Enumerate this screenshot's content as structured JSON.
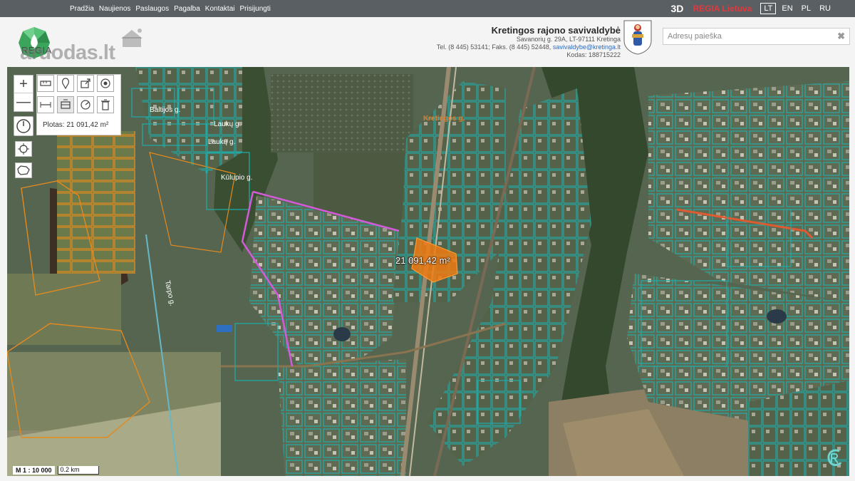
{
  "nav": {
    "items": [
      "Pradžia",
      "Naujienos",
      "Paslaugos",
      "Pagalba",
      "Kontaktai",
      "Prisijungti"
    ],
    "btn_3d": "3D",
    "regia_lietuva": "REGIA Lietuva",
    "languages": [
      "LT",
      "EN",
      "PL",
      "RU"
    ],
    "active_language": "LT"
  },
  "header": {
    "logo_text": "REGIA",
    "watermark": "aruodas.lt",
    "municipality": "Kretingos rajono savivaldybė",
    "address": "Savanorių g. 29A, LT-97111 Kretinga",
    "phone": "Tel. (8 445) 53141; Faks. (8 445) 52448,",
    "email": "savivaldybe@kretinga.lt",
    "code": "Kodas: 188715222",
    "search_placeholder": "Adresų paieška",
    "search_clear": "✖"
  },
  "map": {
    "area_text": "Plotas: 21 091,42 m²",
    "area_label": "21 091,42 m²",
    "scale_ratio": "M 1 : 10 000",
    "scale_distance": "0.2 km",
    "zoom_in": "+",
    "zoom_out": "—",
    "streets": [
      "Kretingos g.",
      "Tarpo g.",
      "Baltijos g.",
      "Laukų g.",
      "Laukų g.",
      "Kūlupio g."
    ]
  },
  "colors": {
    "topbar": "#5a5f63",
    "parcel_line": "#23a7a2",
    "parcel_orange": "#e38a1f",
    "selection_pink": "#d35ad8",
    "selection_fill": "#f07a10",
    "regia_red": "#e0393e",
    "link_blue": "#2a6cc2"
  }
}
